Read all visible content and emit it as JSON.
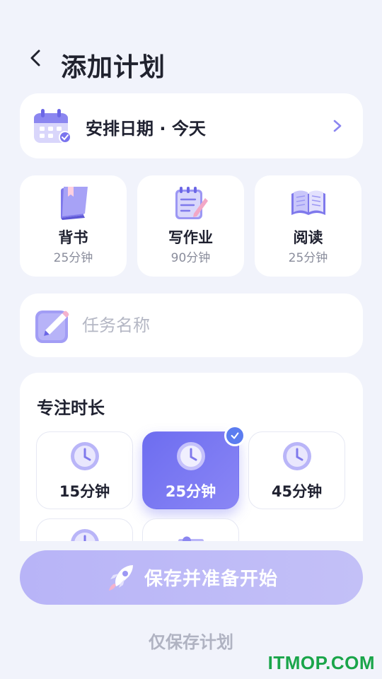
{
  "header": {
    "title": "添加计划"
  },
  "date": {
    "label": "安排日期 · 今天"
  },
  "templates": [
    {
      "name": "背书",
      "duration": "25分钟",
      "icon": "book-icon"
    },
    {
      "name": "写作业",
      "duration": "90分钟",
      "icon": "notepad-icon"
    },
    {
      "name": "阅读",
      "duration": "25分钟",
      "icon": "open-book-icon"
    }
  ],
  "task_name": {
    "placeholder": "任务名称",
    "value": ""
  },
  "duration": {
    "title": "专注时长",
    "options": [
      {
        "label": "15分钟",
        "selected": false
      },
      {
        "label": "25分钟",
        "selected": true
      },
      {
        "label": "45分钟",
        "selected": false
      }
    ]
  },
  "actions": {
    "primary": "保存并准备开始",
    "secondary": "仅保存计划"
  },
  "watermark": "ITMOP.COM",
  "colors": {
    "accent": "#6d6df0",
    "accent_light": "#b8b4f7",
    "check": "#5b7cf0"
  }
}
